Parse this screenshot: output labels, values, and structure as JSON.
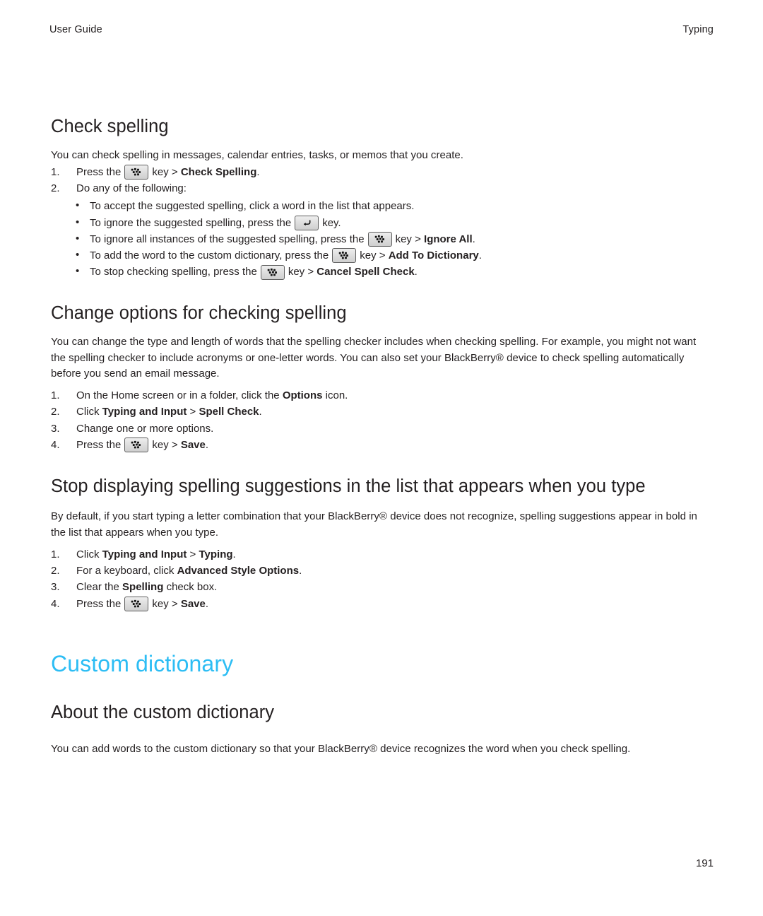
{
  "header": {
    "left": "User Guide",
    "right": "Typing"
  },
  "page_number": "191",
  "colors": {
    "chapter_title": "#2cbdf4",
    "body_text": "#231f20",
    "key_icon_border": "#5e5e5e",
    "key_icon_face": "#dcdcdc"
  },
  "icons": {
    "menu_key": "blackberry-menu-key-icon",
    "escape_key": "escape-back-key-icon"
  },
  "sections": {
    "check_spelling": {
      "heading": "Check spelling",
      "intro": "You can check spelling in messages, calendar entries, tasks, or memos that you create.",
      "steps": [
        {
          "num": "1.",
          "pre": "Press the",
          "icon": "menu_key",
          "mid": "key >",
          "bold": "Check Spelling",
          "post": "."
        },
        {
          "num": "2.",
          "text": "Do any of the following:"
        }
      ],
      "bullets": [
        {
          "pre": "To accept the suggested spelling, click a word in the list that appears.",
          "icon": null,
          "mid": "",
          "bold": "",
          "post": ""
        },
        {
          "pre": "To ignore the suggested spelling, press the",
          "icon": "escape_key",
          "mid": "key.",
          "bold": "",
          "post": ""
        },
        {
          "pre": "To ignore all instances of the suggested spelling, press the",
          "icon": "menu_key",
          "mid": "key >",
          "bold": "Ignore All",
          "post": "."
        },
        {
          "pre": "To add the word to the custom dictionary, press the",
          "icon": "menu_key",
          "mid": "key >",
          "bold": "Add To Dictionary",
          "post": "."
        },
        {
          "pre": "To stop checking spelling, press the",
          "icon": "menu_key",
          "mid": "key >",
          "bold": "Cancel Spell Check",
          "post": "."
        }
      ]
    },
    "change_options": {
      "heading": "Change options for checking spelling",
      "paragraph_1": "You can change the type and length of words that the spelling checker includes when checking spelling. For example, you might not want the spelling checker to include acronyms or one-letter words. You can also set your BlackBerry® device to check spelling automatically before you send an email message.",
      "steps": [
        {
          "num": "1.",
          "pre": "On the Home screen or in a folder, click the",
          "bold": "Options",
          "post": "icon."
        },
        {
          "num": "2.",
          "pre": "Click",
          "bold": "Typing and Input",
          "mid": ">",
          "bold2": "Spell Check",
          "post": "."
        },
        {
          "num": "3.",
          "pre": "Change one or more options."
        },
        {
          "num": "4.",
          "pre": "Press the",
          "icon": "menu_key",
          "mid": "key >",
          "bold": "Save",
          "post": "."
        }
      ]
    },
    "stop_displaying": {
      "heading": "Stop displaying spelling suggestions in the list that appears when you type",
      "paragraph_1": "By default, if you start typing a letter combination that your BlackBerry® device does not recognize, spelling suggestions appear in bold in the list that appears when you type.",
      "steps": [
        {
          "num": "1.",
          "pre": "Click",
          "bold": "Typing and Input",
          "mid": ">",
          "bold2": "Typing",
          "post": "."
        },
        {
          "num": "2.",
          "pre": "For a keyboard, click",
          "bold": "Advanced Style Options",
          "post": "."
        },
        {
          "num": "3.",
          "pre": "Clear the",
          "bold": "Spelling",
          "post": "check box."
        },
        {
          "num": "4.",
          "pre": "Press the",
          "icon": "menu_key",
          "mid": "key >",
          "bold": "Save",
          "post": "."
        }
      ]
    },
    "custom_dictionary": {
      "chapter_title": "Custom dictionary",
      "heading": "About the custom dictionary",
      "paragraph_1": "You can add words to the custom dictionary so that your BlackBerry® device recognizes the word when you check spelling."
    }
  }
}
